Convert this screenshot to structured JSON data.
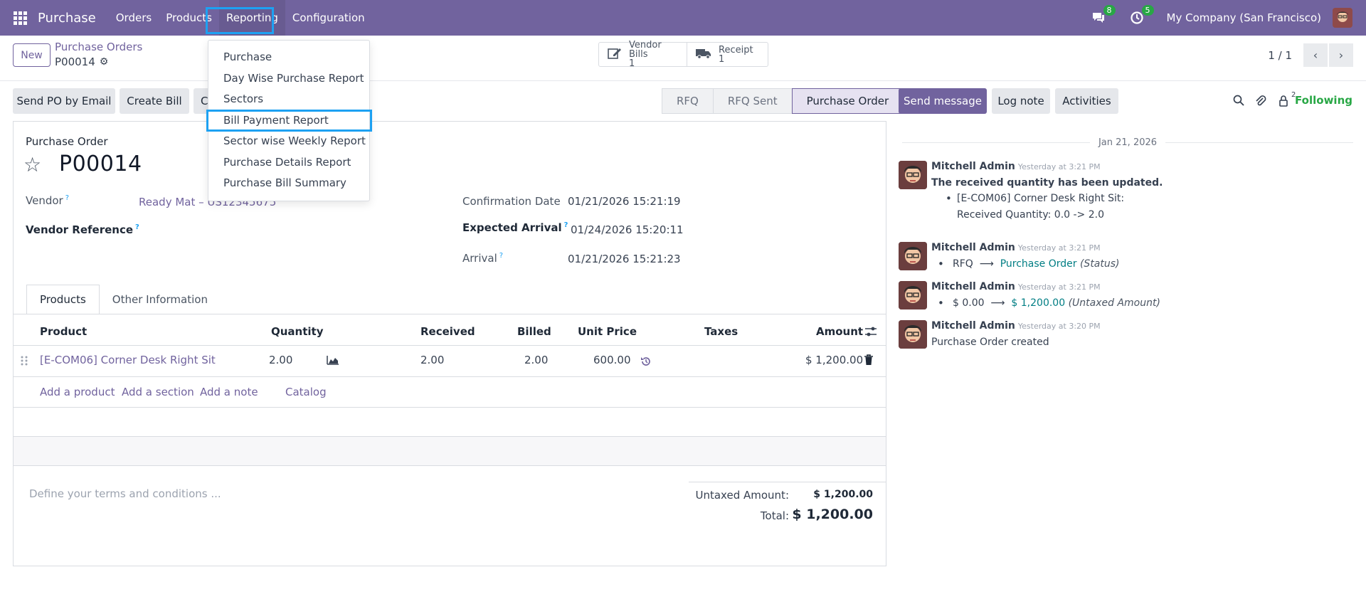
{
  "navbar": {
    "app_name": "Purchase",
    "menus": [
      "Orders",
      "Products",
      "Reporting",
      "Configuration"
    ],
    "messages_badge": "8",
    "activities_badge": "5",
    "company": "My Company (San Francisco)"
  },
  "reporting_menu": {
    "items": [
      "Purchase",
      "Day Wise Purchase Report",
      "Sectors",
      "Bill Payment Report",
      "Sector wise Weekly Report",
      "Purchase Details Report",
      "Purchase Bill Summary"
    ]
  },
  "control": {
    "new_label": "New",
    "breadcrumb": "Purchase Orders",
    "record": "P00014",
    "vendor_bills_label": "Vendor Bills",
    "vendor_bills_count": "1",
    "receipt_label": "Receipt",
    "receipt_count": "1",
    "pager": "1 / 1"
  },
  "actions": {
    "send_po": "Send PO by Email",
    "create_bill": "Create Bill",
    "third_partial": "C"
  },
  "status": {
    "stages": [
      "RFQ",
      "RFQ Sent",
      "Purchase Order"
    ]
  },
  "form": {
    "header_label": "Purchase Order",
    "name": "P00014",
    "vendor_label": "Vendor",
    "vendor_value": "Ready Mat – US12345675",
    "vendor_ref_label": "Vendor Reference",
    "confirmation_label": "Confirmation Date",
    "confirmation_value": "01/21/2026 15:21:19",
    "expected_label": "Expected Arrival",
    "expected_value": "01/24/2026 15:20:11",
    "arrival_label": "Arrival",
    "arrival_value": "01/21/2026 15:21:23",
    "help_mark": "?",
    "tabs": [
      "Products",
      "Other Information"
    ]
  },
  "table": {
    "headers": [
      "Product",
      "Quantity",
      "Received",
      "Billed",
      "Unit Price",
      "Taxes",
      "Amount"
    ],
    "rows": [
      {
        "product": "[E-COM06] Corner Desk Right Sit",
        "quantity": "2.00",
        "received": "2.00",
        "billed": "2.00",
        "unit_price": "600.00",
        "taxes": "",
        "amount": "$ 1,200.00"
      }
    ],
    "add_links": [
      "Add a product",
      "Add a section",
      "Add a note",
      "Catalog"
    ]
  },
  "footer": {
    "terms_placeholder": "Define your terms and conditions ...",
    "untaxed_label": "Untaxed Amount:",
    "untaxed_value": "$ 1,200.00",
    "total_label": "Total:",
    "total_value": "$ 1,200.00"
  },
  "chatter": {
    "send_message": "Send message",
    "log_note": "Log note",
    "activities": "Activities",
    "followers_count": "2",
    "following": "Following",
    "date": "Jan 21, 2026",
    "messages": [
      {
        "author": "Mitchell Admin",
        "time": "Yesterday at 3:21 PM",
        "title": "The received quantity has been updated.",
        "line1": "[E-COM06] Corner Desk Right Sit:",
        "line2": "Received Quantity: 0.0 -> 2.0"
      },
      {
        "author": "Mitchell Admin",
        "time": "Yesterday at 3:21 PM",
        "old": "RFQ",
        "new": "Purchase Order",
        "field": "(Status)"
      },
      {
        "author": "Mitchell Admin",
        "time": "Yesterday at 3:21 PM",
        "old": "$ 0.00",
        "new": "$ 1,200.00",
        "field": "(Untaxed Amount)"
      },
      {
        "author": "Mitchell Admin",
        "time": "Yesterday at 3:20 PM",
        "body": "Purchase Order created"
      }
    ]
  },
  "colors": {
    "brand": "#71639e",
    "highlight": "#1da1f2",
    "following": "#28a745",
    "teal": "#017e84"
  }
}
